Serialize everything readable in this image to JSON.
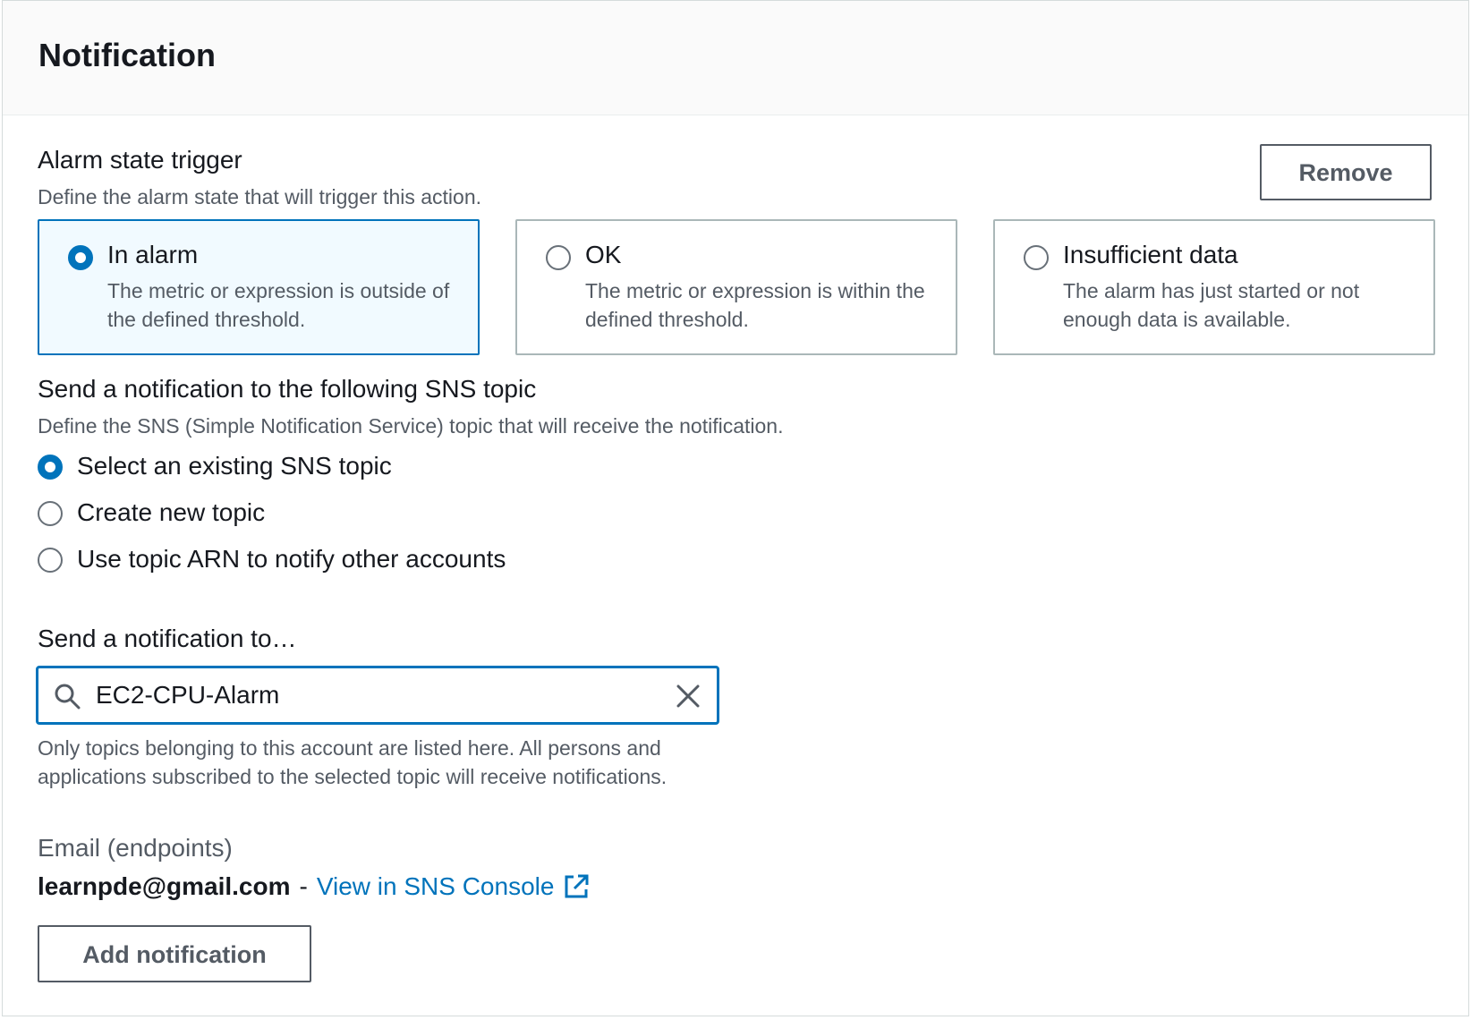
{
  "panel": {
    "title": "Notification"
  },
  "trigger": {
    "label": "Alarm state trigger",
    "description": "Define the alarm state that will trigger this action.",
    "remove_label": "Remove",
    "tiles": [
      {
        "title": "In alarm",
        "description": "The metric or expression is outside of the defined threshold.",
        "selected": true
      },
      {
        "title": "OK",
        "description": "The metric or expression is within the defined threshold.",
        "selected": false
      },
      {
        "title": "Insufficient data",
        "description": "The alarm has just started or not enough data is available.",
        "selected": false
      }
    ]
  },
  "sns": {
    "label": "Send a notification to the following SNS topic",
    "description": "Define the SNS (Simple Notification Service) topic that will receive the notification.",
    "options": [
      {
        "label": "Select an existing SNS topic",
        "selected": true
      },
      {
        "label": "Create new topic",
        "selected": false
      },
      {
        "label": "Use topic ARN to notify other accounts",
        "selected": false
      }
    ]
  },
  "send_to": {
    "label": "Send a notification to…",
    "value": "EC2-CPU-Alarm",
    "search_icon": "search-icon",
    "clear_icon": "close-icon",
    "hint": "Only topics belonging to this account are listed here. All persons and applications subscribed to the selected topic will receive notifications."
  },
  "endpoints": {
    "label": "Email (endpoints)",
    "email": "learnpde@gmail.com",
    "separator": "-",
    "link_text": "View in SNS Console",
    "link_icon": "external-link-icon"
  },
  "add_notification_label": "Add notification",
  "colors": {
    "accent": "#0073bb",
    "selected_tile_bg": "#f1faff",
    "text": "#16191f",
    "secondary_text": "#545b64"
  }
}
